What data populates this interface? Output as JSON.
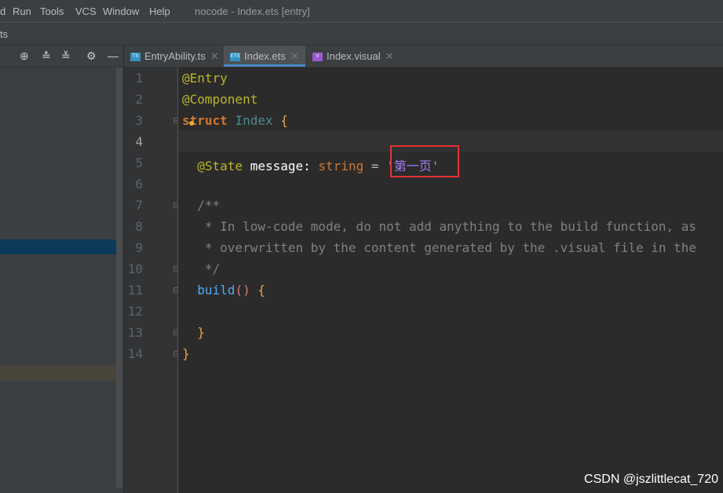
{
  "menu": {
    "items": [
      "d",
      "Run",
      "Tools",
      "VCS",
      "Window",
      "Help"
    ],
    "title": "nocode - Index.ets [entry]"
  },
  "nav": {
    "crumb": "ts"
  },
  "tabs": [
    {
      "label": "EntryAbility.ts",
      "icon": "TS",
      "color": "#3592c4"
    },
    {
      "label": "Index.ets",
      "icon": "ETS",
      "color": "#3592c4",
      "active": true
    },
    {
      "label": "Index.visual",
      "icon": "V",
      "color": "#9b59d0"
    }
  ],
  "lines": [
    "1",
    "2",
    "3",
    "4",
    "5",
    "6",
    "7",
    "8",
    "9",
    "10",
    "11",
    "12",
    "13",
    "14"
  ],
  "code": {
    "l1": "@Entry",
    "l2": "@Component",
    "l3a": "struct",
    "l3b": "Index",
    "l3c": "{",
    "l5a": "@State",
    "l5b": "message",
    "l5c": ":",
    "l5d": "string",
    "l5e": "=",
    "l5f": "'第一页'",
    "l7": "/**",
    "l8": " * In low-code mode, do not add anything to the build function, as",
    "l9": " * overwritten by the content generated by the .visual file in the",
    "l10": " */",
    "l11a": "build",
    "l11b": "()",
    "l11c": "{",
    "l13": "}",
    "l14": "}"
  },
  "watermark": "CSDN @jszlittlecat_720"
}
